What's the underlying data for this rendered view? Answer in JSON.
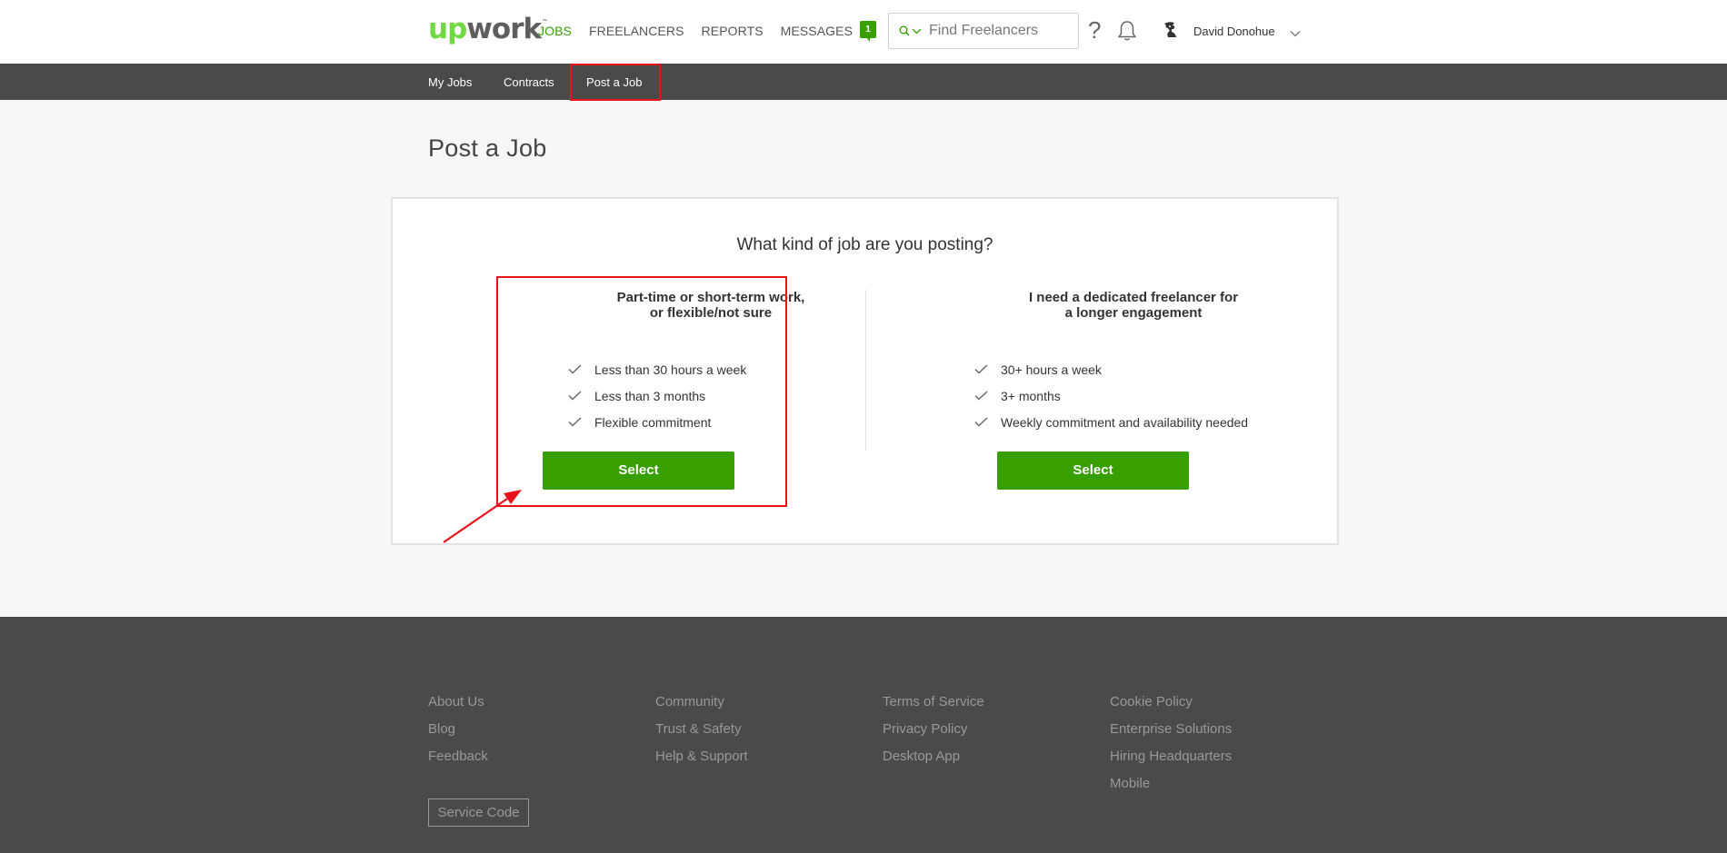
{
  "header": {
    "logo_up": "up",
    "logo_work": "work",
    "logo_tm": "™",
    "nav": [
      {
        "label": "JOBS",
        "active": true
      },
      {
        "label": "FREELANCERS",
        "active": false
      },
      {
        "label": "REPORTS",
        "active": false
      },
      {
        "label": "MESSAGES",
        "active": false,
        "badge": "1"
      }
    ],
    "search": {
      "placeholder": "Find Freelancers",
      "value": ""
    },
    "help_glyph": "?",
    "user_name": "David Donohue"
  },
  "subnav": {
    "items": [
      {
        "label": "My Jobs"
      },
      {
        "label": "Contracts"
      },
      {
        "label": "Post a Job"
      }
    ]
  },
  "main": {
    "page_title": "Post a Job",
    "question": "What kind of job are you posting?",
    "options": [
      {
        "title_line1": "Part-time or short-term work,",
        "title_line2": "or flexible/not sure",
        "features": [
          "Less than 30 hours a week",
          "Less than 3 months",
          "Flexible commitment"
        ],
        "button_label": "Select"
      },
      {
        "title_line1": "I need a dedicated freelancer for",
        "title_line2": "a longer engagement",
        "features": [
          "30+ hours a week",
          "3+ months",
          "Weekly commitment and availability needed"
        ],
        "button_label": "Select"
      }
    ]
  },
  "footer": {
    "columns": [
      [
        "About Us",
        "Blog",
        "Feedback"
      ],
      [
        "Community",
        "Trust & Safety",
        "Help & Support"
      ],
      [
        "Terms of Service",
        "Privacy Policy",
        "Desktop App"
      ],
      [
        "Cookie Policy",
        "Enterprise Solutions",
        "Hiring Headquarters",
        "Mobile"
      ]
    ],
    "service_code_label": "Service Code"
  },
  "colors": {
    "brand_green": "#37a000",
    "logo_green": "#6fda44",
    "annotation_red": "#e8121b",
    "subnav_bg": "#4a4a4a"
  },
  "icons": [
    "search-icon",
    "chevron-down-icon",
    "help-icon",
    "bell-icon",
    "avatar",
    "checkmark-icon"
  ]
}
